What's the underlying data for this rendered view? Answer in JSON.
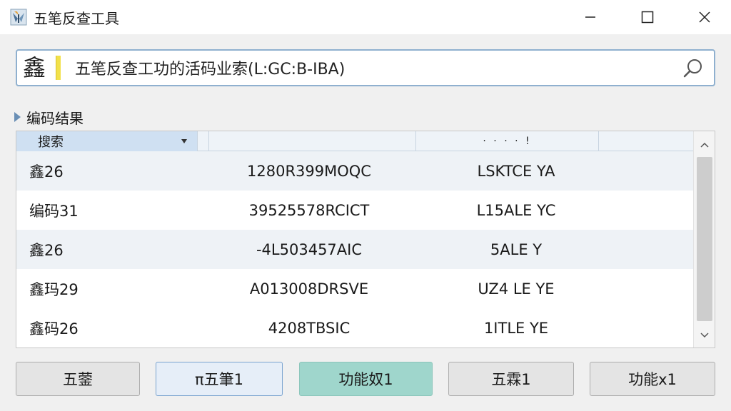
{
  "window": {
    "title": "五笔反查工具",
    "icon": "app-butterfly-icon"
  },
  "search": {
    "input_char": "鑫",
    "hint": "五笔反查工功的活码业索(L:GC:B-IBA)",
    "icon": "search-icon"
  },
  "section": {
    "label": "编码结果"
  },
  "table": {
    "header": {
      "col1": "搜索",
      "col2": "",
      "col3": "· · · · !",
      "col4": ""
    },
    "rows": [
      {
        "c1": "鑫26",
        "c2": "1280R399MOQC",
        "c3": "LSKTCE YA"
      },
      {
        "c1": "编码31",
        "c2": "39525578RCICT",
        "c3": "L15ALE YC"
      },
      {
        "c1": "鑫26",
        "c2": "-4L503457AIC",
        "c3": "5ALE Y"
      },
      {
        "c1": "鑫玛29",
        "c2": "A013008DRSVE",
        "c3": "UZ4 LE YE"
      },
      {
        "c1": "鑫码26",
        "c2": "4208TBSIC",
        "c3": "1ITLE YE"
      }
    ]
  },
  "buttons": {
    "b1": "五蓥",
    "b2": "π五筆1",
    "b3": "功能奴1",
    "b4": "五霖1",
    "b5": "功能x1"
  },
  "colors": {
    "accent_primary": "#9fd6cc",
    "accent_selected": "#cfe0f2",
    "caret": "#f2e14a",
    "border_focus": "#8fb0cf"
  }
}
